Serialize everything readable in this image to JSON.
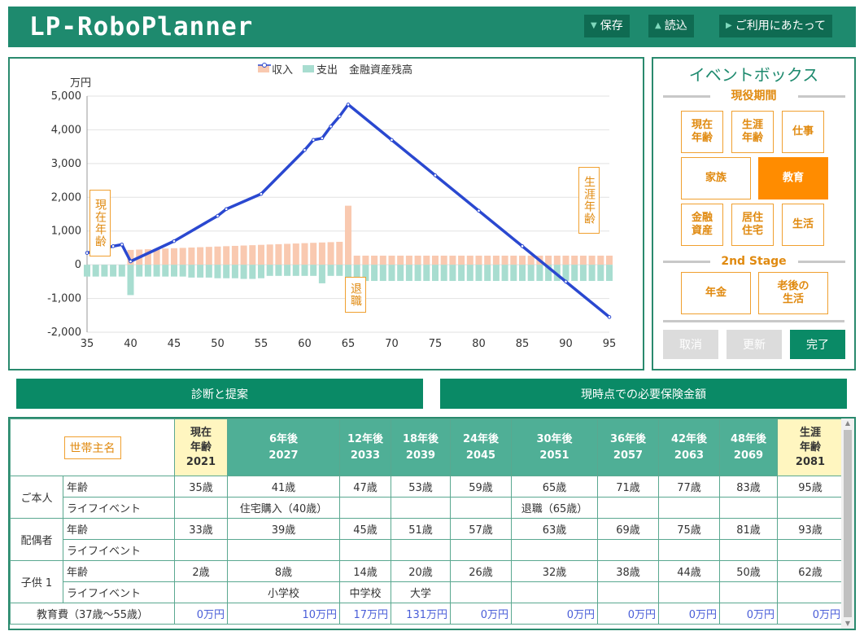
{
  "app": {
    "title": "LP-RoboPlanner"
  },
  "header_buttons": [
    {
      "label": "保存",
      "icon": "▼"
    },
    {
      "label": "読込",
      "icon": "▲"
    },
    {
      "label": "ご利用にあたって",
      "icon": "▶"
    }
  ],
  "chart_data": {
    "type": "bar",
    "ylabel": "万円",
    "x_range": [
      35,
      95
    ],
    "ylim": [
      -2000,
      5000
    ],
    "x_ticks": [
      "35",
      "40",
      "45",
      "50",
      "55",
      "60",
      "65",
      "70",
      "75",
      "80",
      "85",
      "90",
      "95"
    ],
    "y_ticks": [
      "5,000",
      "4,000",
      "3,000",
      "2,000",
      "1,000",
      "0",
      "-1,000",
      "-2,000"
    ],
    "legend": {
      "income": "収入",
      "expense": "支出",
      "balance": "金融資産残高"
    },
    "colors": {
      "income": "#f9c9b0",
      "expense": "#a8ddd0",
      "balance": "#2a48d0"
    },
    "series": [
      {
        "name": "収入",
        "ages": [
          35,
          36,
          37,
          38,
          39,
          40,
          41,
          42,
          43,
          44,
          45,
          46,
          47,
          48,
          49,
          50,
          51,
          52,
          53,
          54,
          55,
          56,
          57,
          58,
          59,
          60,
          61,
          62,
          63,
          64,
          65,
          66,
          67,
          68,
          69,
          70,
          71,
          72,
          73,
          74,
          75,
          76,
          77,
          78,
          79,
          80,
          81,
          82,
          83,
          84,
          85,
          86,
          87,
          88,
          89,
          90,
          91,
          92,
          93,
          94,
          95
        ],
        "values": [
          0,
          0,
          0,
          0,
          0,
          440,
          450,
          460,
          470,
          480,
          490,
          500,
          510,
          520,
          530,
          540,
          550,
          560,
          570,
          580,
          590,
          600,
          610,
          620,
          630,
          640,
          650,
          660,
          670,
          680,
          1750,
          270,
          270,
          270,
          270,
          270,
          270,
          270,
          270,
          270,
          270,
          270,
          270,
          270,
          270,
          270,
          270,
          270,
          270,
          270,
          270,
          270,
          270,
          270,
          270,
          270,
          270,
          270,
          270,
          270,
          270
        ]
      },
      {
        "name": "支出",
        "ages": [
          35,
          36,
          37,
          38,
          39,
          40,
          41,
          42,
          43,
          44,
          45,
          46,
          47,
          48,
          49,
          50,
          51,
          52,
          53,
          54,
          55,
          56,
          57,
          58,
          59,
          60,
          61,
          62,
          63,
          64,
          65,
          66,
          67,
          68,
          69,
          70,
          71,
          72,
          73,
          74,
          75,
          76,
          77,
          78,
          79,
          80,
          81,
          82,
          83,
          84,
          85,
          86,
          87,
          88,
          89,
          90,
          91,
          92,
          93,
          94,
          95
        ],
        "values": [
          -350,
          -350,
          -350,
          -350,
          -350,
          -900,
          -350,
          -350,
          -350,
          -350,
          -350,
          -350,
          -380,
          -380,
          -380,
          -400,
          -400,
          -400,
          -420,
          -420,
          -400,
          -330,
          -330,
          -330,
          -330,
          -330,
          -330,
          -550,
          -330,
          -330,
          -480,
          -480,
          -480,
          -480,
          -480,
          -480,
          -480,
          -480,
          -480,
          -480,
          -480,
          -480,
          -480,
          -480,
          -480,
          -480,
          -480,
          -480,
          -480,
          -480,
          -480,
          -480,
          -480,
          -480,
          -480,
          -480,
          -480,
          -480,
          -480,
          -480,
          -480
        ]
      },
      {
        "name": "金融資産残高",
        "ages": [
          35,
          38,
          39,
          40,
          45,
          50,
          51,
          55,
          60,
          61,
          62,
          63,
          64,
          65,
          70,
          75,
          80,
          85,
          90,
          95
        ],
        "values": [
          350,
          550,
          600,
          100,
          700,
          1450,
          1650,
          2100,
          3400,
          3700,
          3750,
          4100,
          4400,
          4750,
          3700,
          2650,
          1600,
          550,
          -500,
          -1550
        ]
      }
    ]
  },
  "chart_markers": {
    "current_age": "現在年齢",
    "retire": "退職",
    "lifetime": "生涯年齢"
  },
  "eventbox": {
    "title": "イベントボックス",
    "sections": [
      "現役期間",
      "2nd Stage"
    ],
    "buttons": {
      "current_age": "現在\n年齢",
      "lifetime_age": "生涯\n年齢",
      "work": "仕事",
      "family": "家族",
      "education": "教育",
      "financial": "金融\n資産",
      "housing": "居住\n住宅",
      "life": "生活",
      "pension": "年金",
      "retired_life": "老後の\n生活"
    },
    "actions": {
      "cancel": "取消",
      "update": "更新",
      "done": "完了"
    }
  },
  "actions": {
    "diagnosis": "診断と提案",
    "insurance": "現時点での必要保険金額"
  },
  "table": {
    "owner_button": "世帯主名",
    "columns": [
      {
        "label": "現在\n年齢\n2021",
        "highlight": true
      },
      {
        "label": "6年後\n2027"
      },
      {
        "label": "12年後\n2033"
      },
      {
        "label": "18年後\n2039"
      },
      {
        "label": "24年後\n2045"
      },
      {
        "label": "30年後\n2051"
      },
      {
        "label": "36年後\n2057"
      },
      {
        "label": "42年後\n2063"
      },
      {
        "label": "48年後\n2069"
      },
      {
        "label": "生涯\n年齢\n2081",
        "highlight": true
      }
    ],
    "groups": [
      {
        "name": "ご本人",
        "rows": [
          {
            "label": "年齢",
            "cells": [
              "35歳",
              "41歳",
              "47歳",
              "53歳",
              "59歳",
              "65歳",
              "71歳",
              "77歳",
              "83歳",
              "95歳"
            ]
          },
          {
            "label": "ライフイベント",
            "cells": [
              "",
              "住宅購入（40歳）",
              "",
              "",
              "",
              "退職（65歳）",
              "",
              "",
              "",
              ""
            ]
          }
        ]
      },
      {
        "name": "配偶者",
        "rows": [
          {
            "label": "年齢",
            "cells": [
              "33歳",
              "39歳",
              "45歳",
              "51歳",
              "57歳",
              "63歳",
              "69歳",
              "75歳",
              "81歳",
              "93歳"
            ]
          },
          {
            "label": "ライフイベント",
            "cells": [
              "",
              "",
              "",
              "",
              "",
              "",
              "",
              "",
              "",
              ""
            ]
          }
        ]
      },
      {
        "name": "子供 1",
        "rows": [
          {
            "label": "年齢",
            "cells": [
              "2歳",
              "8歳",
              "14歳",
              "20歳",
              "26歳",
              "32歳",
              "38歳",
              "44歳",
              "50歳",
              "62歳"
            ]
          },
          {
            "label": "ライフイベント",
            "cells": [
              "",
              "小学校",
              "中学校",
              "大学",
              "",
              "",
              "",
              "",
              "",
              ""
            ]
          }
        ]
      }
    ],
    "education_row": {
      "label": "教育費（37歳～55歳）",
      "cells": [
        "0万円",
        "10万円",
        "17万円",
        "131万円",
        "0万円",
        "0万円",
        "0万円",
        "0万円",
        "0万円",
        "0万円"
      ]
    }
  }
}
